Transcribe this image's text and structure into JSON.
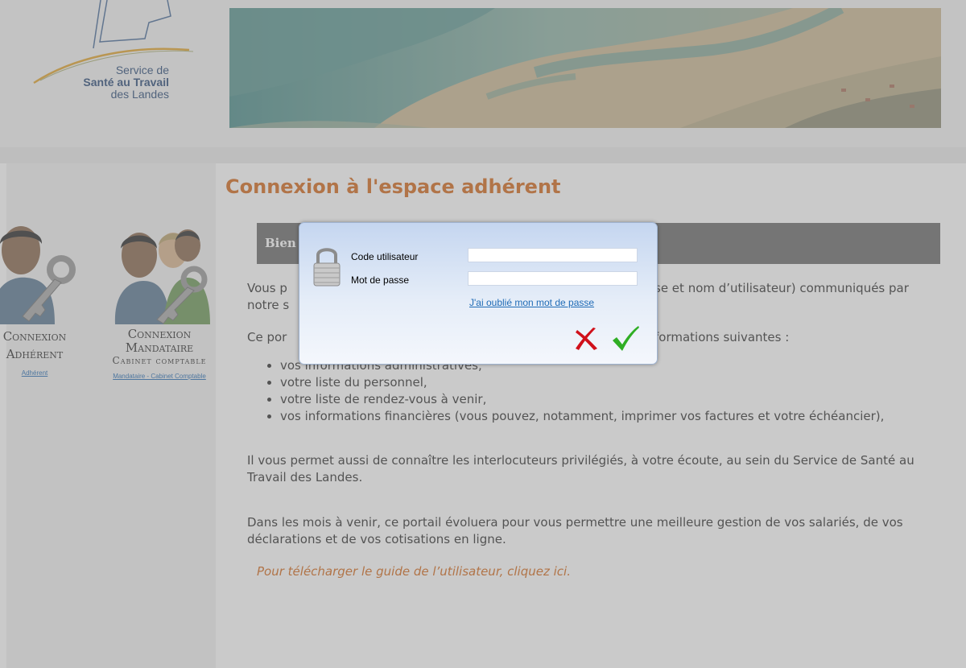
{
  "header": {
    "logo_lines": [
      "Service de",
      "Santé au Travail",
      "des Landes"
    ]
  },
  "sidebar": {
    "adherent": {
      "title_line1": "Connexion",
      "title_line2": "Adhérent",
      "link": "Adhérent"
    },
    "mandataire": {
      "title_line1": "Connexion",
      "title_line2": "Mandataire",
      "subtitle": "Cabinet comptable",
      "link": "Mandataire - Cabinet Comptable"
    }
  },
  "main": {
    "title": "Connexion à l'espace adhérent",
    "bar_text": "Bien",
    "para1_start": "Vous p",
    "para1_end": "se et nom d’utilisateur) communiqués par",
    "para1_line2": "notre s",
    "para2_start": "Ce por",
    "para2_end": "formations suivantes :",
    "features": [
      "vos informations administratives,",
      "votre liste du personnel,",
      "votre liste de rendez-vous à venir,",
      "vos informations financières (vous pouvez, notamment, imprimer vos factures et votre échéancier),"
    ],
    "para3": "Il vous permet aussi de connaître les interlocuteurs privilégiés, à votre écoute, au sein du Service de Santé au Travail des Landes.",
    "para4": "Dans les mois à venir, ce portail évoluera pour vous permettre une meilleure gestion de vos salariés, de vos déclarations et de vos cotisations en ligne.",
    "guide_link": "Pour télécharger le guide de l’utilisateur, cliquez ici."
  },
  "dialog": {
    "username_label": "Code utilisateur",
    "username_value": "",
    "password_label": "Mot de passe",
    "password_value": "",
    "forgot_link": "J'ai oublié mon mot de passe",
    "cancel_icon": "red-x-icon",
    "confirm_icon": "green-check-icon"
  },
  "colors": {
    "accent_orange": "#d46c1f",
    "link_blue": "#1f6bb6",
    "bar_gray": "#6d6d6d"
  }
}
